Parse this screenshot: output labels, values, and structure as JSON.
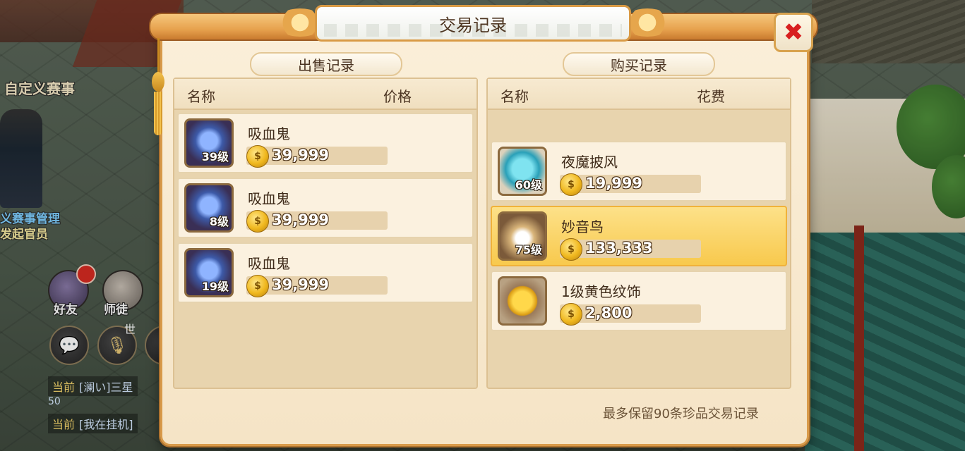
{
  "scene": {
    "left_labels": {
      "custom_event": "自定义赛事",
      "admin_line1": "义赛事管理",
      "admin_line2": "发起官员"
    },
    "quick_buttons": {
      "friends": "好友",
      "master": "师徒",
      "world": "世"
    },
    "chat": [
      {
        "tag": "当前",
        "text": "[澜い]三星",
        "icon": "chat-line"
      },
      {
        "tag": "当前",
        "text": "[我在挂机]",
        "icon": "chat-line"
      }
    ],
    "chat_extra": "50"
  },
  "dialog": {
    "title": "交易记录",
    "close_icon": "close-x",
    "sell": {
      "header": "出售记录",
      "col_name": "名称",
      "col_price": "价格",
      "rows": [
        {
          "name": "吸血鬼",
          "level": "39级",
          "price": "39,999",
          "icon": "vampire"
        },
        {
          "name": "吸血鬼",
          "level": "8级",
          "price": "39,999",
          "icon": "vampire"
        },
        {
          "name": "吸血鬼",
          "level": "19级",
          "price": "39,999",
          "icon": "vampire"
        }
      ]
    },
    "buy": {
      "header": "购买记录",
      "col_name": "名称",
      "col_cost": "花费",
      "rows": [
        {
          "name": "夜魔披风",
          "level": "60级",
          "price": "19,999",
          "icon": "cloak",
          "selected": false
        },
        {
          "name": "妙音鸟",
          "level": "75级",
          "price": "133,333",
          "icon": "bird",
          "selected": true
        },
        {
          "name": "1级黄色纹饰",
          "level": "",
          "price": "2,800",
          "icon": "gold-ornament",
          "selected": false
        }
      ]
    },
    "footer": "最多保留90条珍品交易记录"
  },
  "colors": {
    "frame": "#d89a4a",
    "parchment": "#fbefd9",
    "selected_row": "#f8c94d",
    "close_x": "#d81f1f"
  }
}
